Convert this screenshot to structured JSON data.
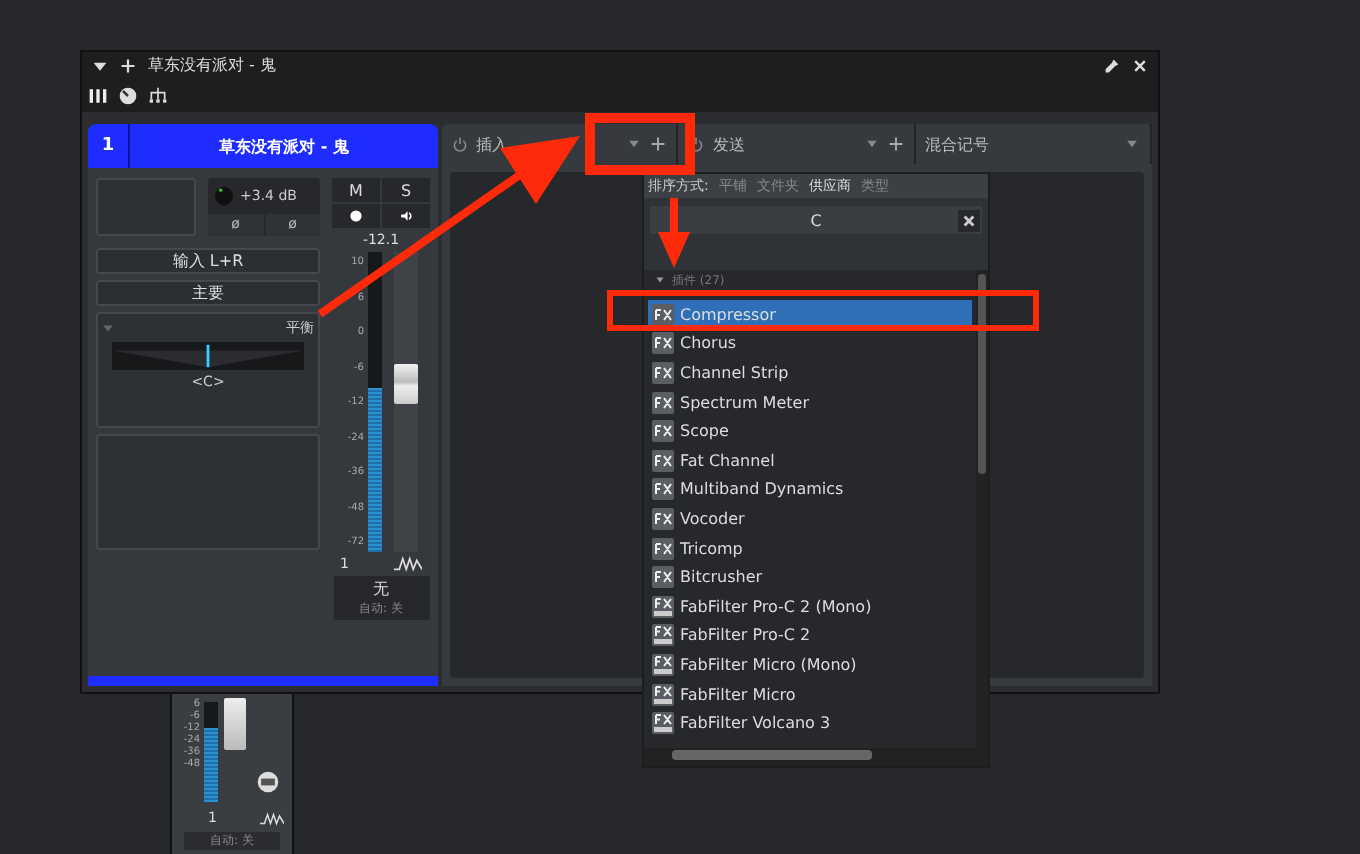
{
  "window": {
    "title": "草东没有派对 - 鬼"
  },
  "channel": {
    "number": "1",
    "name": "草东没有派对 - 鬼",
    "gain": "+3.4 dB",
    "phase_buttons": [
      "ø",
      "ø"
    ],
    "mute": "M",
    "solo": "S",
    "input": "输入 L+R",
    "output": "主要",
    "pan_label": "平衡",
    "pan_value": "<C>",
    "pan": {
      "level": 0.5
    },
    "level_reading": "-12.1",
    "meter": {
      "level": 0.55
    },
    "fader": {
      "level": 0.6
    },
    "scale": [
      "10",
      "6",
      "0",
      "-6",
      "-12",
      "-24",
      "-36",
      "-48",
      "-72"
    ],
    "channel_index": "1",
    "automation_value": "无",
    "automation_mode": "自动: 关"
  },
  "sections": [
    {
      "label": "插入"
    },
    {
      "label": "发送"
    },
    {
      "label": "混合记号"
    }
  ],
  "plugin_browser": {
    "sort_label": "排序方式:",
    "sort_options": [
      {
        "label": "平铺",
        "selected": false
      },
      {
        "label": "文件夹",
        "selected": false
      },
      {
        "label": "供应商",
        "selected": true
      },
      {
        "label": "类型",
        "selected": false
      }
    ],
    "search": "C",
    "group": "插件 (27)",
    "items": [
      {
        "name": "Compressor",
        "kind": "fx",
        "selected": true
      },
      {
        "name": "Chorus",
        "kind": "fx",
        "selected": false
      },
      {
        "name": "Channel Strip",
        "kind": "fx",
        "selected": false
      },
      {
        "name": "Spectrum Meter",
        "kind": "fx",
        "selected": false
      },
      {
        "name": "Scope",
        "kind": "fx",
        "selected": false
      },
      {
        "name": "Fat Channel",
        "kind": "fx",
        "selected": false
      },
      {
        "name": "Multiband Dynamics",
        "kind": "fx",
        "selected": false
      },
      {
        "name": "Vocoder",
        "kind": "fx",
        "selected": false
      },
      {
        "name": "Tricomp",
        "kind": "fx",
        "selected": false
      },
      {
        "name": "Bitcrusher",
        "kind": "fx",
        "selected": false
      },
      {
        "name": "FabFilter Pro-C 2 (Mono)",
        "kind": "vst",
        "selected": false
      },
      {
        "name": "FabFilter Pro-C 2",
        "kind": "vst",
        "selected": false
      },
      {
        "name": "FabFilter Micro (Mono)",
        "kind": "vst",
        "selected": false
      },
      {
        "name": "FabFilter Micro",
        "kind": "vst",
        "selected": false
      },
      {
        "name": "FabFilter Volcano 3",
        "kind": "vst",
        "selected": false
      }
    ]
  },
  "bottom_strip": {
    "scale": [
      "6",
      "-6",
      "-12",
      "-24",
      "-36",
      "-48"
    ],
    "channel_index": "1",
    "automation_mode": "自动: 关",
    "meter": {
      "level": 0.75
    }
  }
}
